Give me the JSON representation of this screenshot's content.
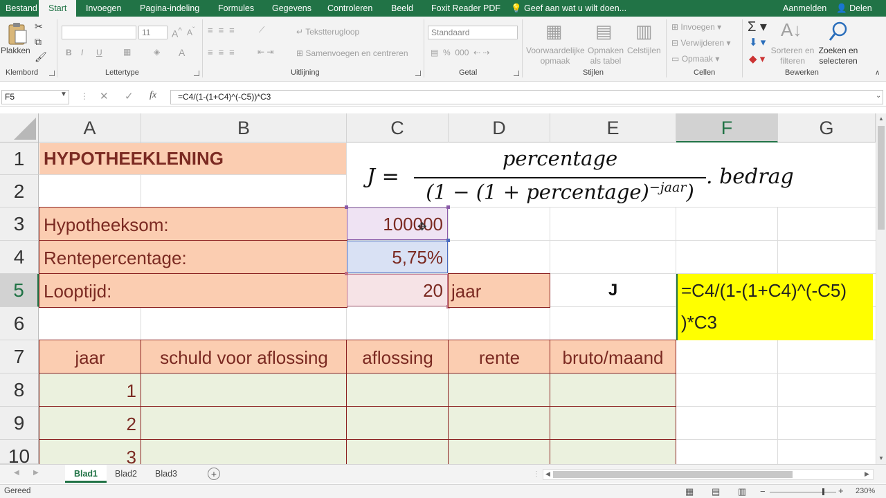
{
  "menu": {
    "file": "Bestand",
    "tabs": [
      "Start",
      "Invoegen",
      "Pagina-indeling",
      "Formules",
      "Gegevens",
      "Controleren",
      "Beeld",
      "Foxit Reader PDF"
    ],
    "tell_me": "Geef aan wat u wilt doen...",
    "sign_in": "Aanmelden",
    "share": "Delen"
  },
  "ribbon": {
    "paste": "Plakken",
    "clipboard_group": "Klembord",
    "font_group": "Lettertype",
    "font_size": "11",
    "bold": "B",
    "italic": "I",
    "underline": "U",
    "wrap_text": "Tekstterugloop",
    "merge_center": "Samenvoegen en centreren",
    "alignment_group": "Uitlijning",
    "number_format": "Standaard",
    "number_group": "Getal",
    "conditional_1": "Voorwaardelijke",
    "conditional_2": "opmaak",
    "format_table_1": "Opmaken",
    "format_table_2": "als tabel",
    "cell_styles": "Celstijlen",
    "styles_group": "Stijlen",
    "insert": "Invoegen",
    "delete": "Verwijderen",
    "format": "Opmaak",
    "cells_group": "Cellen",
    "sort_1": "Sorteren en",
    "sort_2": "filteren",
    "find_1": "Zoeken en",
    "find_2": "selecteren",
    "editing_group": "Bewerken"
  },
  "formula_bar": {
    "name_box": "F5",
    "fx": "fx",
    "formula": "=C4/(1-(1+C4)^(-C5))*C3"
  },
  "columns": [
    "A",
    "B",
    "C",
    "D",
    "E",
    "F",
    "G"
  ],
  "rows": [
    "1",
    "2",
    "3",
    "4",
    "5",
    "6",
    "7",
    "8",
    "9",
    "10"
  ],
  "sheet": {
    "title": "HYPOTHEEKLENING",
    "label_sum": "Hypotheeksom:",
    "label_rate": "Rentepercentage:",
    "label_term": "Looptijd:",
    "value_sum": "100000",
    "value_rate": "5,75%",
    "value_term": "20",
    "unit_term": "jaar",
    "j_label": "J",
    "f5_edit_line1": "=C4/(1-(1+C4)^(-C5)",
    "f5_edit_line2": ")*C3",
    "headers": [
      "jaar",
      "schuld voor aflossing",
      "aflossing",
      "rente",
      "bruto/maand"
    ],
    "years": [
      "1",
      "2",
      "3"
    ]
  },
  "equation": {
    "lhs": "J =",
    "numerator": "percentage",
    "denominator": "(1 − (1 + percentage)",
    "exponent": "−jaar",
    "denominator_close": ")",
    "tail": ". bedrag"
  },
  "sheet_tabs": [
    "Blad1",
    "Blad2",
    "Blad3"
  ],
  "status": {
    "ready": "Gereed",
    "zoom": "230%"
  },
  "colors": {
    "excel_green": "#217346",
    "peach": "#fbcdb1",
    "light_green": "#ebf1de",
    "yellow": "#ffff00",
    "dark_red": "#7b2a22"
  }
}
